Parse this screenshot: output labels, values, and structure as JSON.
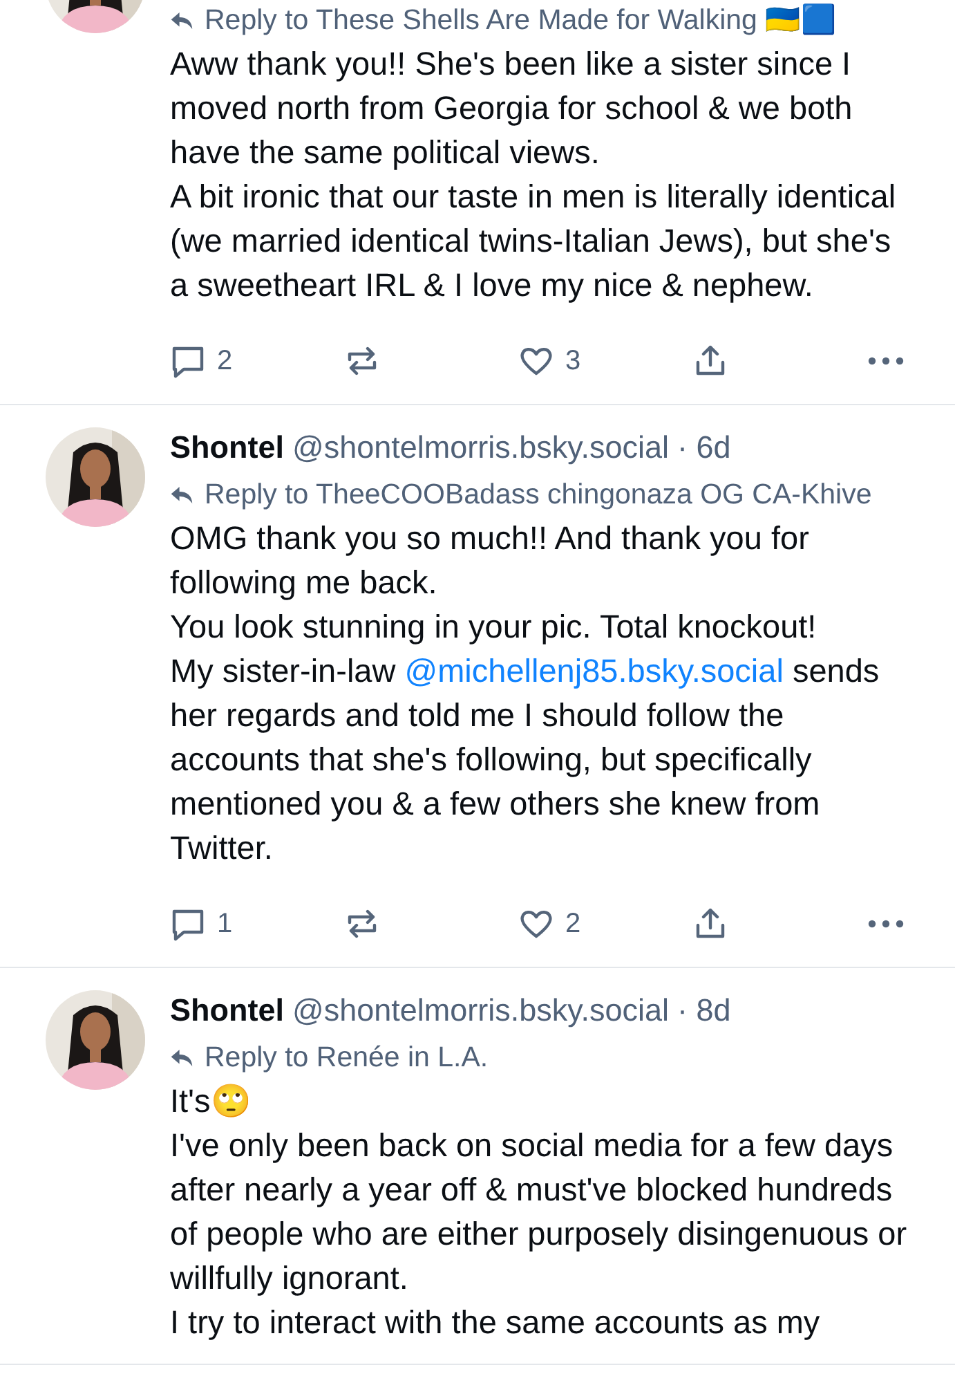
{
  "posts": [
    {
      "reply_to": "Reply to These Shells Are Made for Walking 🇺🇦🟦",
      "body": [
        [
          {
            "kind": "text",
            "text": "Aww thank you!! She's been like a sister since I moved north from Georgia for school & we both have the same political views."
          }
        ],
        [
          {
            "kind": "text",
            "text": "A bit ironic that our taste in men is literally identical (we married identical twins-Italian Jews), but she's a sweetheart IRL & I love my nice & nephew."
          }
        ]
      ],
      "replies": "2",
      "likes": "3"
    },
    {
      "author": "Shontel",
      "handle": "@shontelmorris.bsky.social",
      "time": "· 6d",
      "reply_to": "Reply to TheeCOOBadass chingonaza OG CA-Khive",
      "body": [
        [
          {
            "kind": "text",
            "text": "OMG thank you so much!! And thank you for following me back."
          }
        ],
        [
          {
            "kind": "text",
            "text": "You look stunning in your pic. Total knockout!"
          }
        ],
        [
          {
            "kind": "text",
            "text": "My sister-in-law "
          },
          {
            "kind": "mention",
            "text": "@michellenj85.bsky.social"
          },
          {
            "kind": "text",
            "text": " sends her regards and told me I should follow the accounts that she's following, but specifically mentioned you & a few others she knew from Twitter."
          }
        ]
      ],
      "replies": "1",
      "likes": "2"
    },
    {
      "author": "Shontel",
      "handle": "@shontelmorris.bsky.social",
      "time": "· 8d",
      "reply_to": "Reply to Renée in L.A.",
      "body": [
        [
          {
            "kind": "text",
            "text": "It's🙄"
          }
        ],
        [
          {
            "kind": "text",
            "text": "I've only been back on social media for a few days after nearly a year off & must've blocked hundreds of people who are either purposely disingenuous or willfully ignorant."
          }
        ],
        [
          {
            "kind": "text",
            "text": "I try to interact with the same accounts as my"
          }
        ]
      ]
    }
  ]
}
